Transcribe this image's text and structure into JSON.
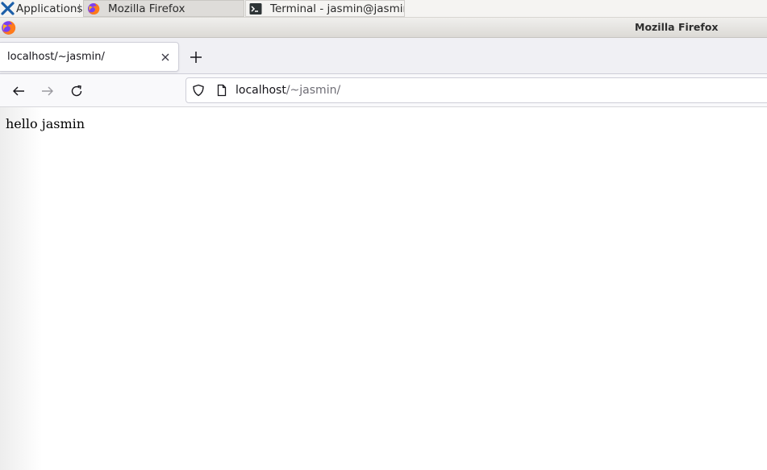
{
  "panel": {
    "apps_menu_label": "Applications",
    "tasks": [
      {
        "label": "Mozilla Firefox",
        "icon": "firefox-icon",
        "active": true
      },
      {
        "label": "Terminal - jasmin@jasmin-...",
        "icon": "terminal-icon",
        "active": false
      }
    ]
  },
  "window": {
    "title": "Mozilla Firefox"
  },
  "browser": {
    "tabs": [
      {
        "title": "localhost/~jasmin/",
        "selected": true
      }
    ],
    "new_tab_icon": "plus-icon",
    "url": {
      "host": "localhost",
      "path": "/~jasmin/"
    }
  },
  "page": {
    "text": "hello jasmin"
  },
  "colors": {
    "panel_bg": "#f5f4f2",
    "tabstrip_bg": "#f0f0f4",
    "navbar_bg": "#f9f9fb",
    "url_path": "#6e6d75"
  }
}
